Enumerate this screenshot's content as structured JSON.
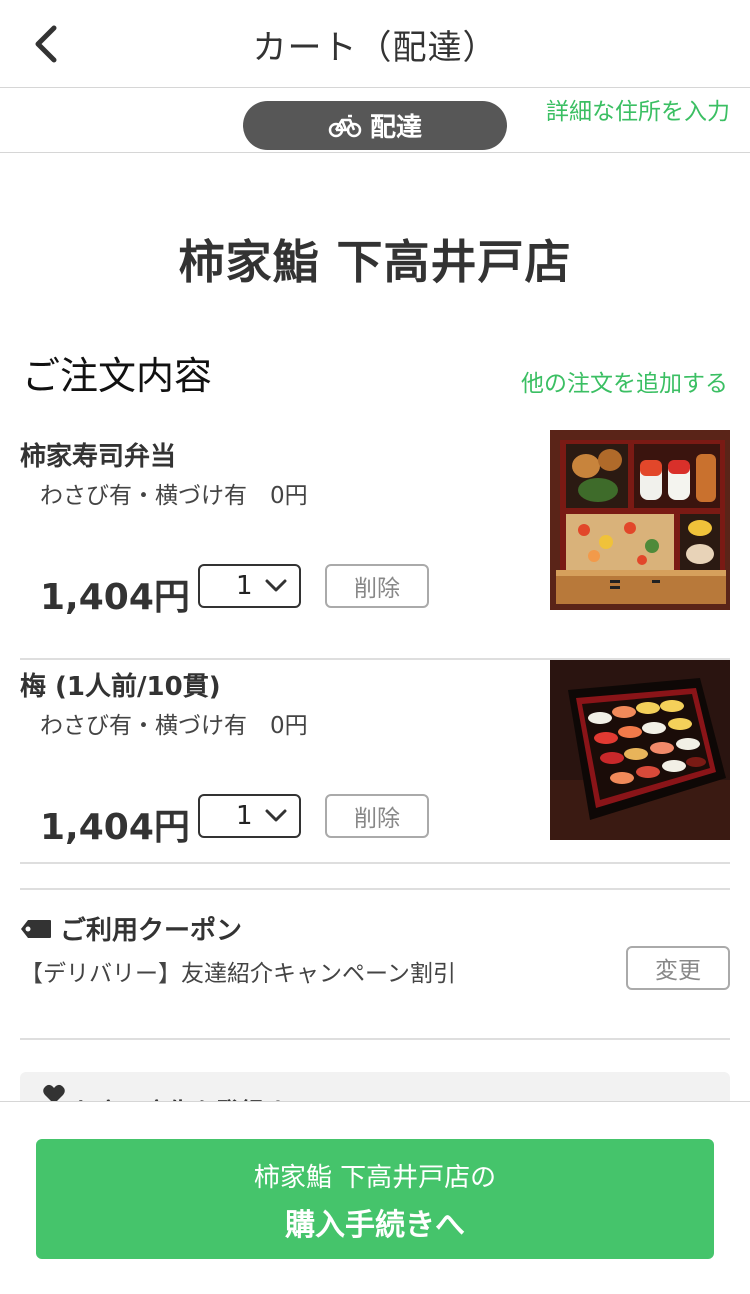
{
  "header": {
    "title": "カート（配達）"
  },
  "mode": {
    "label": "配達",
    "address_link": "詳細な住所を入力"
  },
  "shop": {
    "name": "柿家鮨 下高井戸店"
  },
  "order": {
    "section_title": "ご注文内容",
    "add_link": "他の注文を追加する",
    "items": [
      {
        "name": "柿家寿司弁当",
        "options": "わさび有・横づけ有　0円",
        "price": "1,404円",
        "quantity": "1",
        "delete_label": "削除"
      },
      {
        "name": "梅 (1人前/10貫)",
        "options": "わさび有・横づけ有　0円",
        "price": "1,404円",
        "quantity": "1",
        "delete_label": "削除"
      }
    ]
  },
  "coupon": {
    "title": "ご利用クーポン",
    "description": "【デリバリー】友達紹介キャンペーン割引",
    "change_label": "変更"
  },
  "favorite": {
    "label": "お店・広告を登録する"
  },
  "checkout": {
    "line1": "柿家鮨 下高井戸店の",
    "line2": "購入手続きへ"
  },
  "colors": {
    "accent": "#45c46b",
    "link": "#3bbf63",
    "pill": "#575757"
  }
}
